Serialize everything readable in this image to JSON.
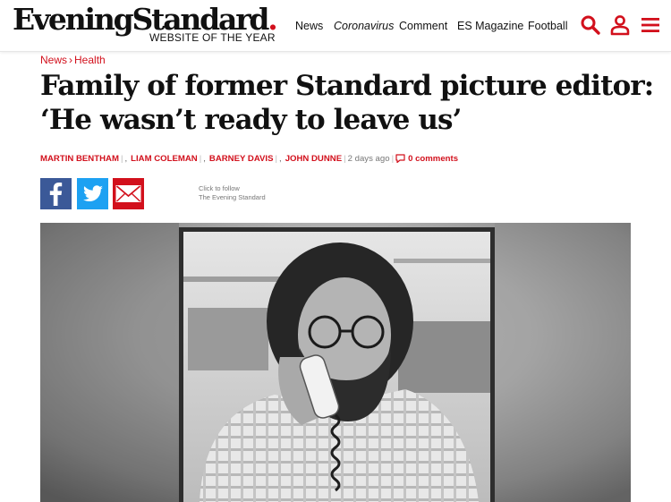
{
  "header": {
    "logo_text": "EveningStandard",
    "logo_dot": ".",
    "tagline": "WEBSITE OF THE YEAR",
    "nav": [
      "News",
      "Coronavirus",
      "Comment",
      "ES Magazine",
      "Football"
    ],
    "icons": [
      "search-icon",
      "account-icon",
      "menu-icon"
    ],
    "accent_color": "#d2101c"
  },
  "breadcrumb": {
    "section": "News",
    "separator": "›",
    "subsection": "Health"
  },
  "article": {
    "headline_line1": "Family of former Standard picture editor:",
    "headline_line2": "‘He wasn’t ready to leave us’",
    "authors": [
      "MARTIN BENTHAM",
      "LIAM COLEMAN",
      "BARNEY DAVIS",
      "JOHN DUNNE"
    ],
    "published": "2 days ago",
    "comments": "0 comments"
  },
  "share": {
    "buttons": [
      "facebook-icon",
      "twitter-icon",
      "email-icon"
    ],
    "follow_line1": "Click to follow",
    "follow_line2": "The Evening Standard"
  },
  "hero_image": {
    "description_icon": "photo-of-man-on-telephone"
  }
}
